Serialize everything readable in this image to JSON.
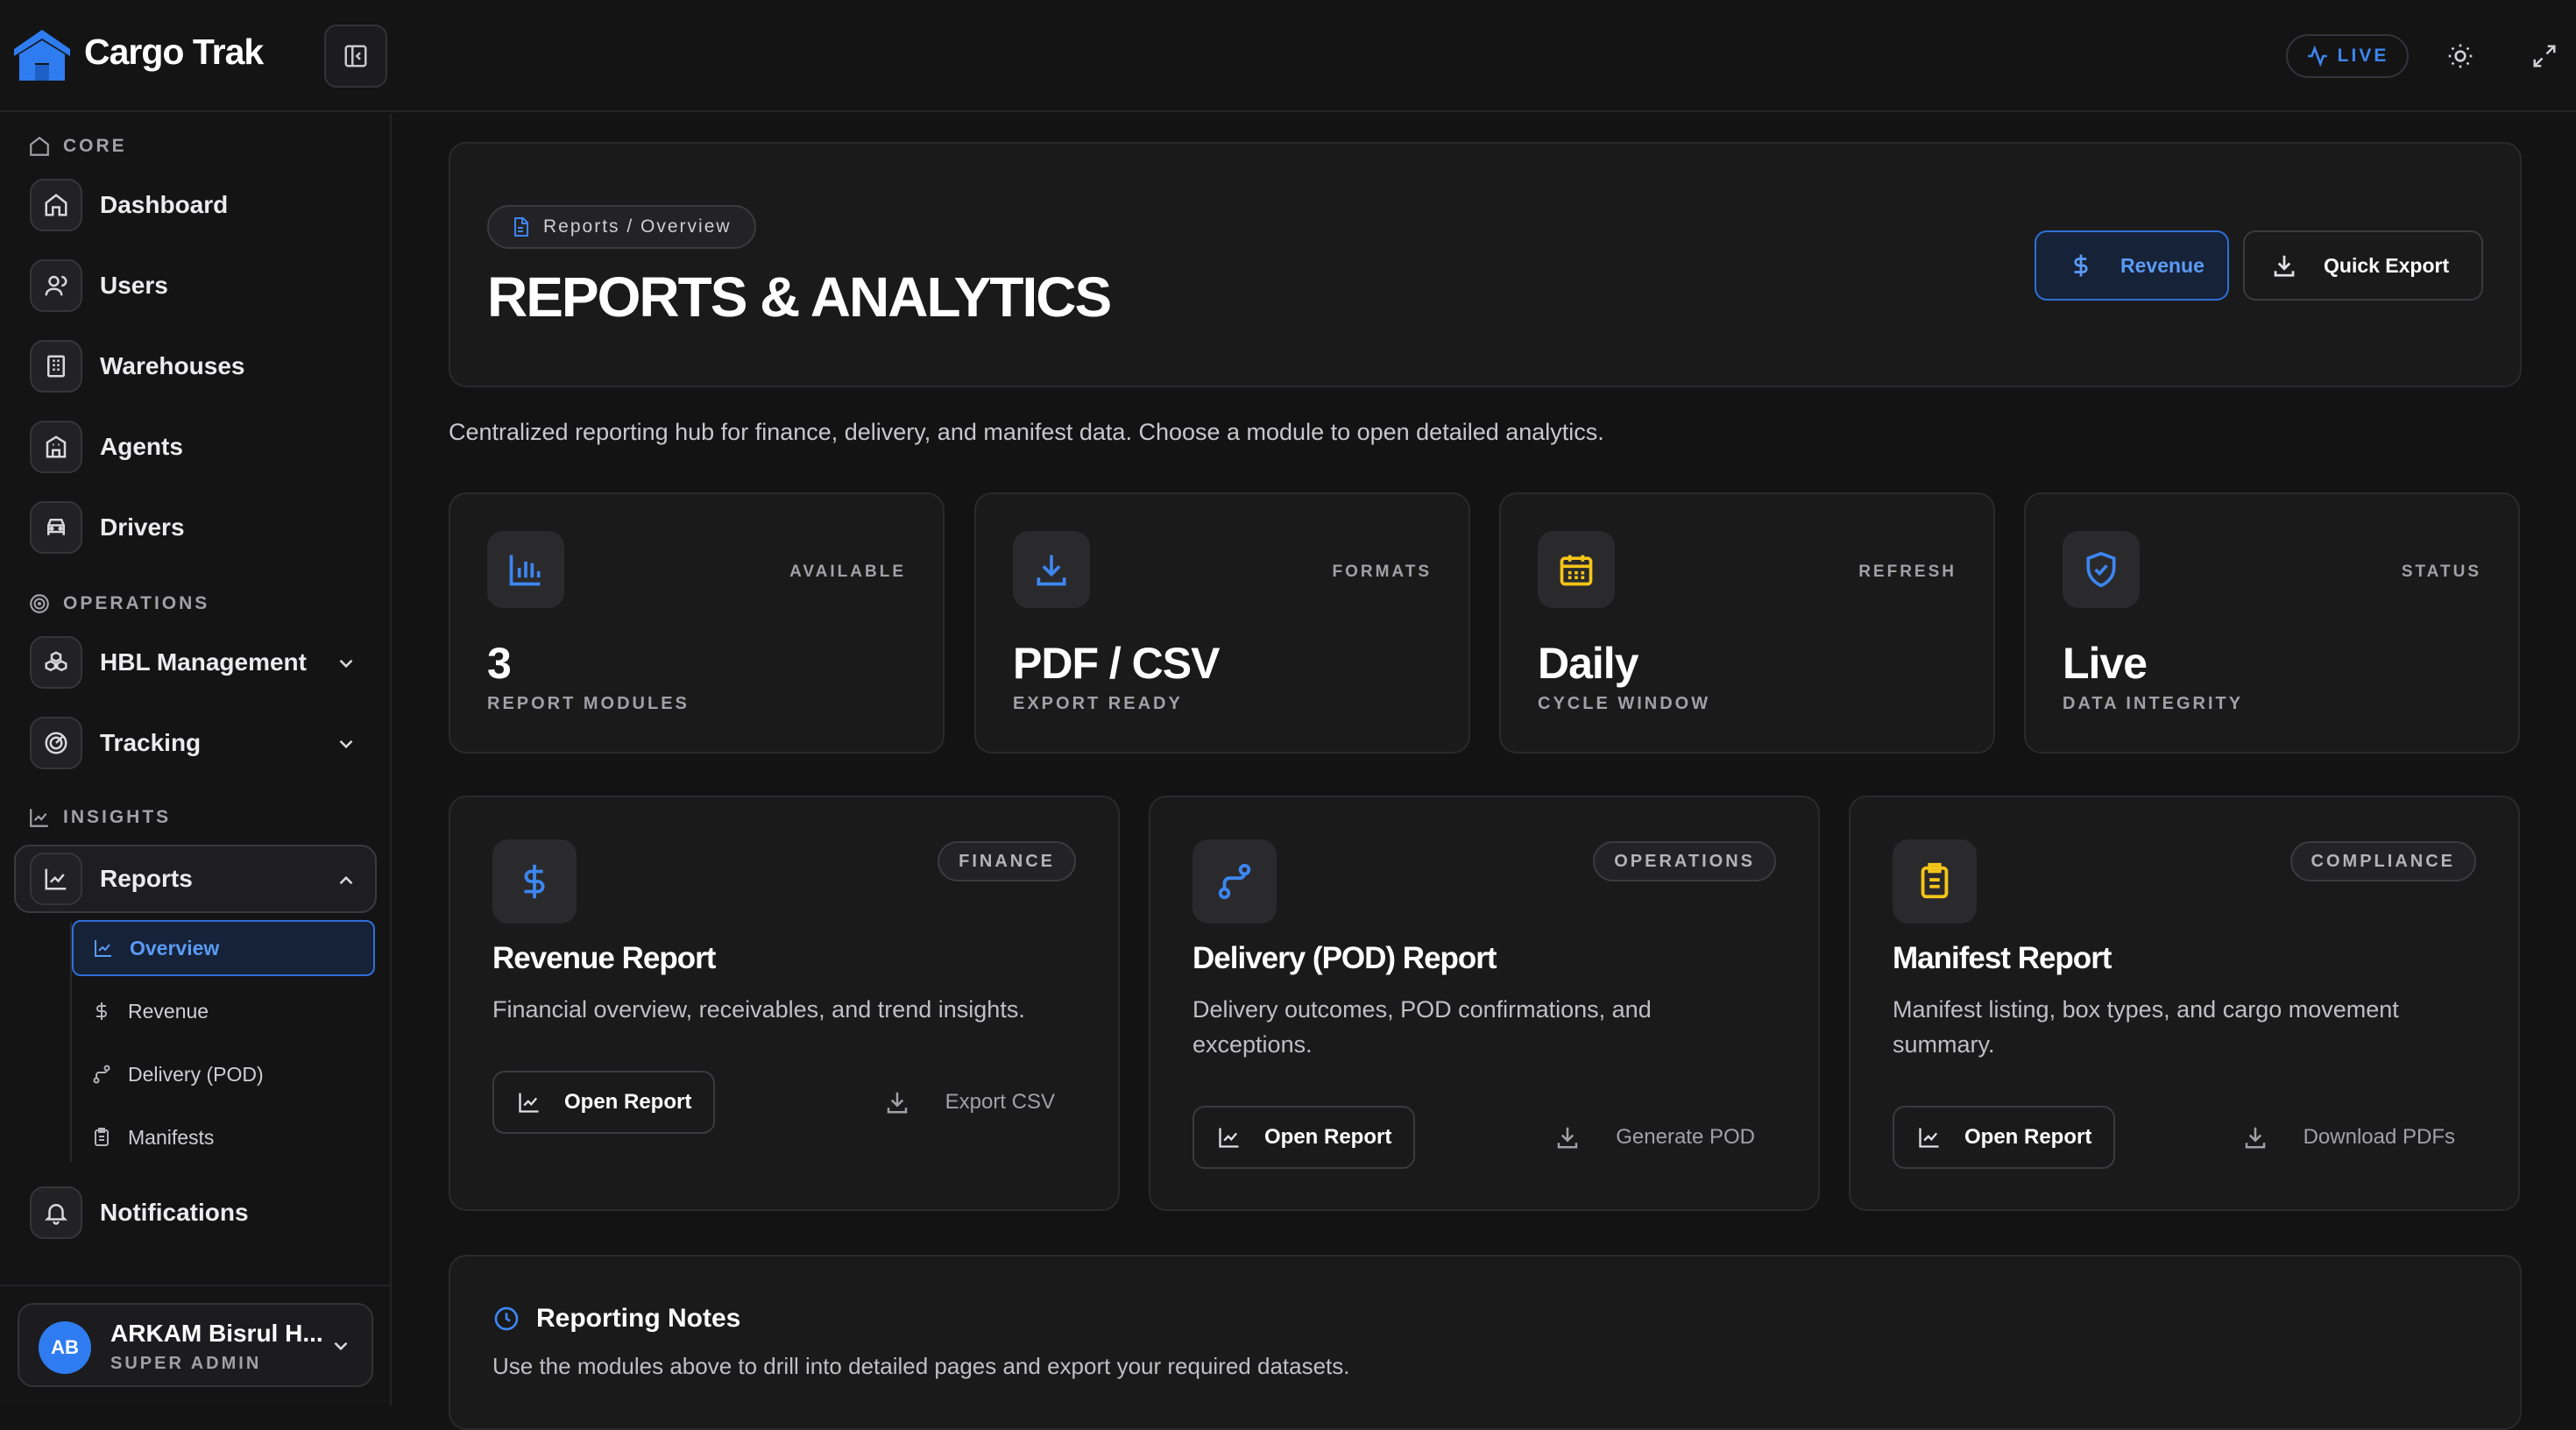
{
  "app": {
    "brand": "Cargo Trak",
    "live_label": "LIVE"
  },
  "sidebar": {
    "sections": {
      "core": "CORE",
      "operations": "OPERATIONS",
      "insights": "INSIGHTS"
    },
    "items": {
      "dashboard": "Dashboard",
      "users": "Users",
      "warehouses": "Warehouses",
      "agents": "Agents",
      "drivers": "Drivers",
      "hbl": "HBL Management",
      "tracking": "Tracking",
      "reports": "Reports",
      "notifications": "Notifications"
    },
    "reports_sub": {
      "overview": "Overview",
      "revenue": "Revenue",
      "delivery": "Delivery (POD)",
      "manifests": "Manifests"
    },
    "user": {
      "initials": "AB",
      "name": "ARKAM Bisrul H...",
      "role": "SUPER ADMIN"
    }
  },
  "header": {
    "breadcrumb": "Reports / Overview",
    "title": "REPORTS & ANALYTICS",
    "revenue_button": "Revenue",
    "export_button": "Quick Export"
  },
  "description": "Centralized reporting hub for finance, delivery, and manifest data. Choose a module to open detailed analytics.",
  "stats": [
    {
      "tag": "AVAILABLE",
      "value": "3",
      "sub": "REPORT MODULES",
      "icon": "bar-chart-icon"
    },
    {
      "tag": "FORMATS",
      "value": "PDF / CSV",
      "sub": "EXPORT READY",
      "icon": "download-icon"
    },
    {
      "tag": "REFRESH",
      "value": "Daily",
      "sub": "CYCLE WINDOW",
      "icon": "calendar-icon"
    },
    {
      "tag": "STATUS",
      "value": "Live",
      "sub": "DATA INTEGRITY",
      "icon": "shield-check-icon"
    }
  ],
  "modules": [
    {
      "tag": "FINANCE",
      "title": "Revenue Report",
      "desc": "Financial overview, receivables, and trend insights.",
      "open": "Open Report",
      "secondary": "Export CSV"
    },
    {
      "tag": "OPERATIONS",
      "title": "Delivery (POD) Report",
      "desc": "Delivery outcomes, POD confirmations, and exceptions.",
      "open": "Open Report",
      "secondary": "Generate POD"
    },
    {
      "tag": "COMPLIANCE",
      "title": "Manifest Report",
      "desc": "Manifest listing, box types, and cargo movement summary.",
      "open": "Open Report",
      "secondary": "Download PDFs"
    }
  ],
  "notes": {
    "title": "Reporting Notes",
    "text": "Use the modules above to drill into detailed pages and export your required datasets."
  },
  "colors": {
    "accent": "#3d86f0",
    "gold": "#f5c518",
    "bg": "#131314",
    "card": "#1a1a1b"
  }
}
